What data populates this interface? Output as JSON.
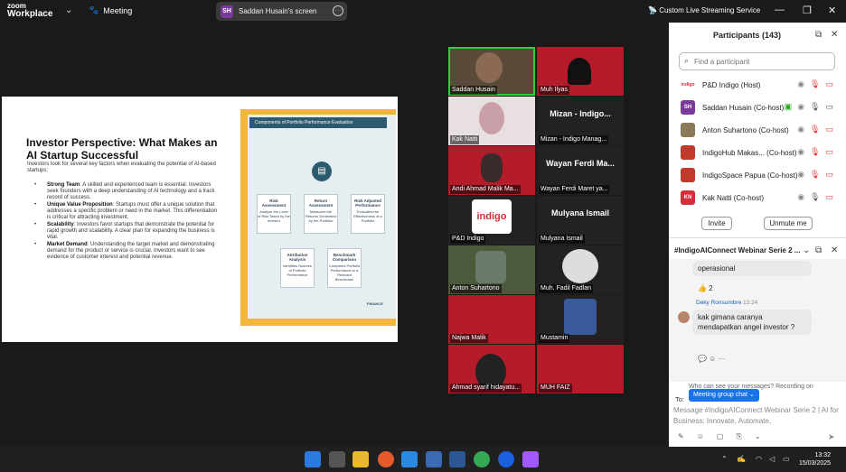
{
  "titlebar": {
    "logo_line1": "zoom",
    "logo_line2": "Workplace",
    "meeting_label": "Meeting",
    "share_initials": "SH",
    "share_label": "Saddan Husain's screen",
    "streaming_label": "Custom Live Streaming Service"
  },
  "slide": {
    "title": "Investor Perspective: What Makes an AI Startup Successful",
    "intro": "Investors look for several key factors when evaluating the potential of AI-based startups:",
    "points": [
      {
        "head": "Strong Team",
        "text": ": A skilled and experienced team is essential. Investors seek founders with a deep understanding of AI technology and a track record of success."
      },
      {
        "head": "Unique Value Proposition",
        "text": ": Startups must offer a unique solution that addresses a specific problem or need in the market. This differentiation is critical for attracting investment."
      },
      {
        "head": "Scalability",
        "text": ": Investors favor startups that demonstrate the potential for rapid growth and scalability. A clear plan for expanding the business is vital."
      },
      {
        "head": "Market Demand",
        "text": ": Understanding the target market and demonstrating demand for the product or service is crucial. Investors want to see evidence of customer interest and potential revenue."
      }
    ],
    "card_header": "Components of Portfolio Performance Evaluation",
    "card_boxes": [
      {
        "title": "Risk Assessment",
        "text": "Analyze the Level of Risk Taken by the Investor"
      },
      {
        "title": "Return Assessment",
        "text": "Measures the Returns Generated by the Portfolio"
      },
      {
        "title": "Risk Adjusted Performance",
        "text": "Evaluates the Effectiveness of a Portfolio"
      },
      {
        "title": "Attribution Analysis",
        "text": "Identifies Sources of Portfolio Performance"
      },
      {
        "title": "Benchmark Comparison",
        "text": "Compares Portfolio Performance to a Relevant Benchmark"
      }
    ],
    "card_logo": "FINANCE"
  },
  "tiles": [
    {
      "label": "Saddan Husain",
      "big": ""
    },
    {
      "label": "Muh Ilyas",
      "big": ""
    },
    {
      "label": "Kak Natti",
      "big": ""
    },
    {
      "label": "Mizan - Indigo Manag...",
      "big": "Mizan - Indigo..."
    },
    {
      "label": "Andi Ahmad Malik Ma...",
      "big": ""
    },
    {
      "label": "Wayan Ferdi Maret ya...",
      "big": "Wayan Ferdi Ma..."
    },
    {
      "label": "P&D Indigo",
      "big": "indigo"
    },
    {
      "label": "Mulyana Ismail",
      "big": "Mulyana Ismail"
    },
    {
      "label": "Anton Suhartono",
      "big": ""
    },
    {
      "label": "Muh. Fadil Fadlan",
      "big": ""
    },
    {
      "label": "Najwa Malik",
      "big": ""
    },
    {
      "label": "Mustamin",
      "big": ""
    },
    {
      "label": "Ahmad syarif hidayatu...",
      "big": ""
    },
    {
      "label": "MUH FAIZ",
      "big": ""
    }
  ],
  "participants": {
    "title": "Participants (143)",
    "search_placeholder": "Find a participant",
    "list": [
      {
        "initials": "",
        "name": "P&D Indigo (Host)",
        "color": "#ffffff"
      },
      {
        "initials": "SH",
        "name": "Saddan Husain (Co-host)",
        "color": "#7a3a9a"
      },
      {
        "initials": "",
        "name": "Anton Suhartono (Co-host)",
        "color": "#8a7a5a"
      },
      {
        "initials": "",
        "name": "IndigoHub Makas... (Co-host)",
        "color": "#c0392b"
      },
      {
        "initials": "",
        "name": "IndigoSpace Papua (Co-host)",
        "color": "#c0392b"
      },
      {
        "initials": "KN",
        "name": "Kak Natti (Co-host)",
        "color": "#d62d3a"
      }
    ],
    "invite_label": "Invite",
    "unmute_label": "Unmute me"
  },
  "chat": {
    "title": "#IndigoAIConnect Webinar Serie 2 ...",
    "prev_message": "operasional",
    "reaction": "👍 2",
    "sender": "Deky Ronsumbre",
    "time": "13:24",
    "message": "kak gimana caranya mendapatkan angel investor ?",
    "who_can_see": "Who can see your messages? Recording on",
    "to_label": "To:",
    "to_value": "Meeting group chat ⌄",
    "input_placeholder": "Message #IndigoAIConnect Webinar Serie 2 | AI for Business: Innovate, Automate,"
  },
  "clock": {
    "time": "13:32",
    "date": "15/03/2025"
  },
  "colors": {
    "accent": "#1a73e8",
    "tile_red": "#b51c2a",
    "active_speaker": "#2ecc40"
  }
}
